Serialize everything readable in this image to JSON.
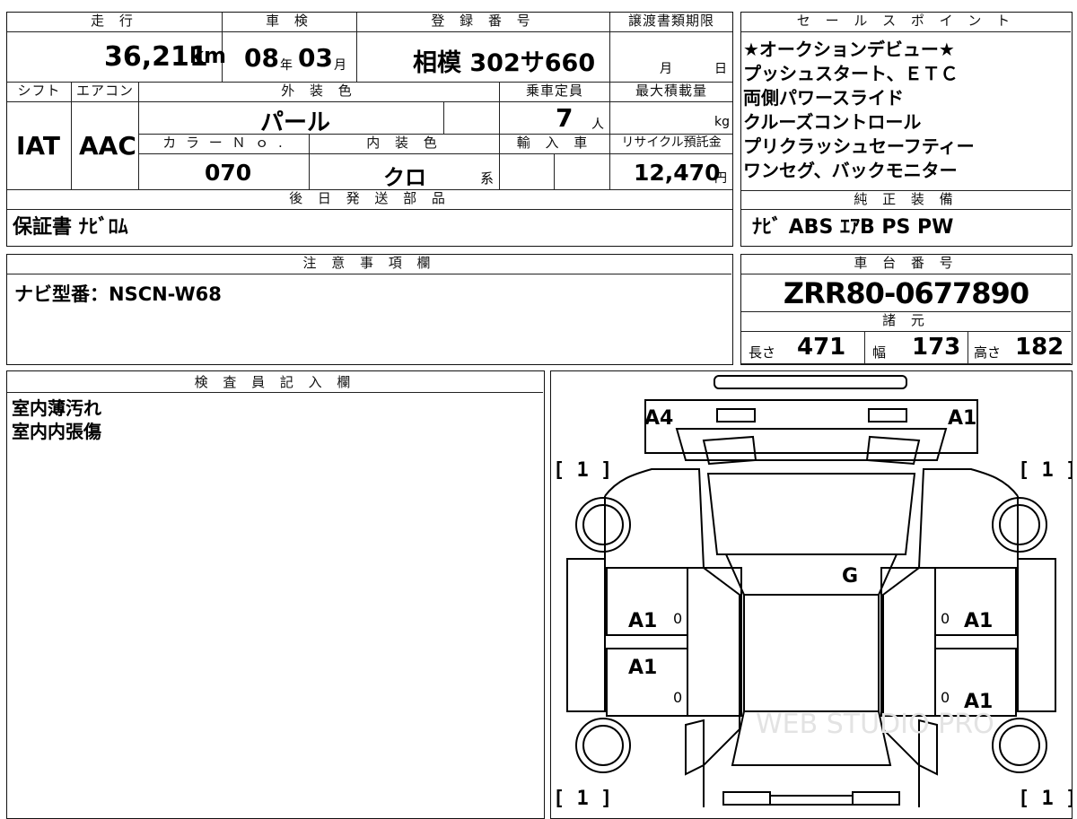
{
  "top_row": {
    "mileage_header": "走 行",
    "mileage_value": "36,211",
    "mileage_unit": "km",
    "inspection_header": "車 検",
    "inspection_year": "08",
    "inspection_year_unit": "年",
    "inspection_month": "03",
    "inspection_month_unit": "月",
    "registration_header": "登 録 番 号",
    "registration_value": "相模 302サ660",
    "transfer_deadline_header": "譲渡書類期限",
    "transfer_month_unit": "月",
    "transfer_day_unit": "日"
  },
  "second_row": {
    "shift_header": "シフト",
    "shift_value": "IAT",
    "aircon_header": "エアコン",
    "aircon_value": "AAC",
    "exterior_color_header": "外 装 色",
    "exterior_color_value": "パール",
    "capacity_header": "乗車定員",
    "capacity_value": "7",
    "capacity_unit": "人",
    "max_load_header": "最大積載量",
    "max_load_unit": "kg",
    "color_no_header": "カ ラ ー Ｎ ｏ .",
    "color_no_value": "070",
    "interior_color_header": "内 装 色",
    "interior_color_value": "クロ",
    "interior_color_suffix": "系",
    "import_header": "輸 入 車",
    "recycle_header": "リサイクル預託金",
    "recycle_value": "12,470",
    "recycle_unit": "円"
  },
  "later_parts": {
    "header": "後 日 発 送 部 品",
    "value": "保証書 ﾅﾋﾞﾛﾑ"
  },
  "sales_points": {
    "header": "セ ー ル ス ポ イ ン ト",
    "lines": [
      "★オークションデビュー★",
      "プッシュスタート、ＥＴＣ",
      "両側パワースライド",
      "クルーズコントロール",
      "プリクラッシュセーフティー",
      "ワンセグ、バックモニター"
    ]
  },
  "genuine_equipment": {
    "header": "純 正 装 備",
    "value": "ﾅﾋﾞ ABS ｴｱB PS PW"
  },
  "notes": {
    "header": "注 意 事 項 欄",
    "value": "ナビ型番：NSCN-W68"
  },
  "chassis": {
    "header": "車 台 番 号",
    "value": "ZRR80-0677890"
  },
  "specs": {
    "header": "諸 元",
    "length_label": "長さ",
    "length_value": "471",
    "width_label": "幅",
    "width_value": "173",
    "height_label": "高さ",
    "height_value": "182"
  },
  "inspector": {
    "header": "検 査 員 記 入 欄",
    "lines": [
      "室内薄汚れ",
      "室内内張傷"
    ]
  },
  "diagram": {
    "marks": {
      "front_left": "A4",
      "front_right": "A1",
      "windshield": "G",
      "left_front_door": "A1",
      "left_rear_door": "A1",
      "right_front_door": "A1",
      "right_rear_door": "A1",
      "tire_fl": "[ 1 ]",
      "tire_fr": "[ 1 ]",
      "tire_rl": "[ 1 ]",
      "tire_rr": "[ 1 ]",
      "zero": "0"
    },
    "watermark": "WEB STUDIO PRO"
  }
}
